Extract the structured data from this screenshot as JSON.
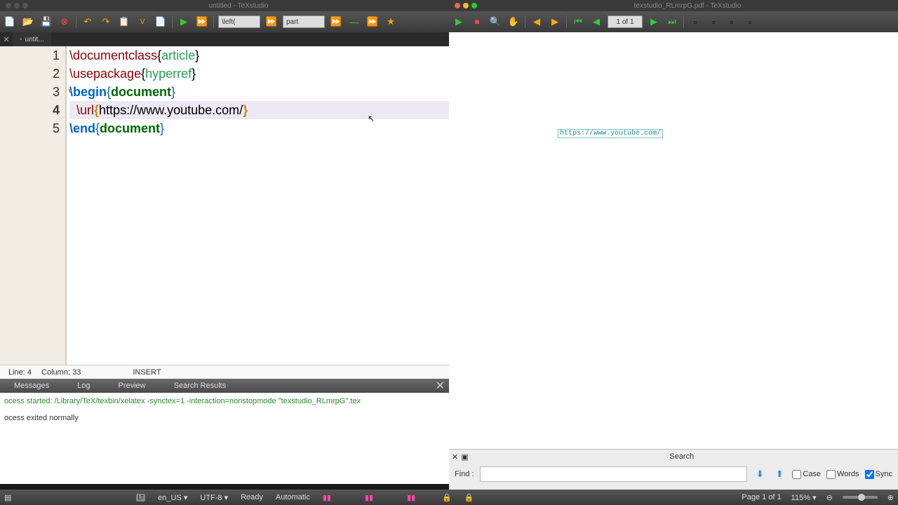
{
  "left_window": {
    "title": "untitled - TeXstudio",
    "tab": "untit...",
    "toolbar_inputs": {
      "left_delim": "\\left(",
      "section": "part"
    },
    "cursor": {
      "line_label": "Line:",
      "line": "4",
      "col_label": "Column:",
      "col": "33",
      "mode": "INSERT"
    },
    "panel_tabs": [
      "Messages",
      "Log",
      "Preview",
      "Search Results"
    ],
    "log_lines": [
      "ocess started: /Library/TeX/texbin/xelatex -synctex=1 -interaction=nonstopmode \"texstudio_RLmrpG\".tex",
      "ocess exited normally"
    ]
  },
  "editor": {
    "lines": [
      {
        "num": "1"
      },
      {
        "num": "2"
      },
      {
        "num": "3"
      },
      {
        "num": "4"
      },
      {
        "num": "5"
      }
    ],
    "tokens": {
      "l1_cmd": "\\documentclass",
      "l1_arg": "article",
      "l2_cmd": "\\usepackage",
      "l2_arg": "hyperref",
      "l3_cmd": "\\begin",
      "l3_arg": "document",
      "l4_cmd": "\\url",
      "l4_url": "https://www.youtube.com/",
      "l5_cmd": "\\end",
      "l5_arg": "document"
    }
  },
  "right_window": {
    "title": "texstudio_RLmrpG.pdf - TeXstudio",
    "page_indicator": "1 of 1",
    "pdf_link_text": "https://www.youtube.com/"
  },
  "search": {
    "title": "Search",
    "find_label": "Find :",
    "case": "Case",
    "words": "Words",
    "sync": "Sync"
  },
  "statusbar": {
    "lt": "LT",
    "lang": "en_US",
    "enc": "UTF-8",
    "state": "Ready",
    "auto": "Automatic",
    "page": "Page 1 of 1",
    "zoom": "115%"
  }
}
